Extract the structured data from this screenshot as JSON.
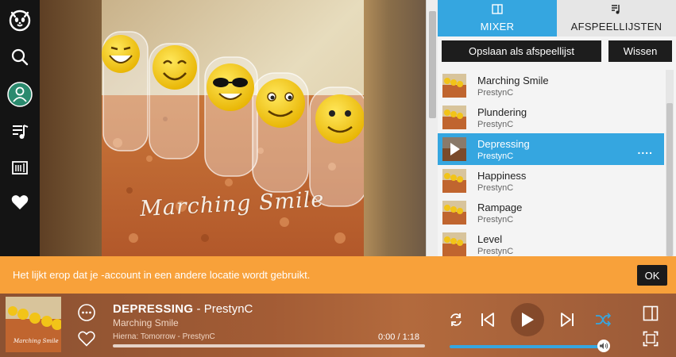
{
  "nav": {
    "items": [
      {
        "icon": "logo-icon"
      },
      {
        "icon": "search-icon"
      },
      {
        "icon": "profile-icon"
      },
      {
        "icon": "music-library-icon"
      },
      {
        "icon": "radio-icon"
      },
      {
        "icon": "heart-icon"
      }
    ]
  },
  "artwork": {
    "caption": "Marching Smile"
  },
  "panel": {
    "tabs": [
      {
        "label": "MIXER",
        "icon": "mixer-icon",
        "active": true
      },
      {
        "label": "AFSPEELLIJSTEN",
        "icon": "playlist-icon",
        "active": false
      }
    ],
    "save_label": "Opslaan als afspeellijst",
    "clear_label": "Wissen",
    "queue": [
      {
        "title": "Marching Smile",
        "artist": "PrestynC",
        "active": false
      },
      {
        "title": "Plundering",
        "artist": "PrestynC",
        "active": false
      },
      {
        "title": "Depressing",
        "artist": "PrestynC",
        "active": true
      },
      {
        "title": "Happiness",
        "artist": "PrestynC",
        "active": false
      },
      {
        "title": "Rampage",
        "artist": "PrestynC",
        "active": false
      },
      {
        "title": "Level",
        "artist": "PrestynC",
        "active": false
      }
    ],
    "more_label": "...."
  },
  "banner": {
    "message": "Het lijkt erop dat je -account in een andere locatie wordt gebruikt.",
    "ok_label": "OK"
  },
  "player": {
    "title": "DEPRESSING",
    "separator": " - ",
    "artist": "PrestynC",
    "album": "Marching Smile",
    "up_next": "Hierna: Tomorrow - PrestynC",
    "time": "0:00 / 1:18",
    "progress": 0.0,
    "volume": 1.0,
    "accent_color": "#35a6e0"
  },
  "colors": {
    "accent": "#35a6e0",
    "banner": "#f8a13a"
  }
}
